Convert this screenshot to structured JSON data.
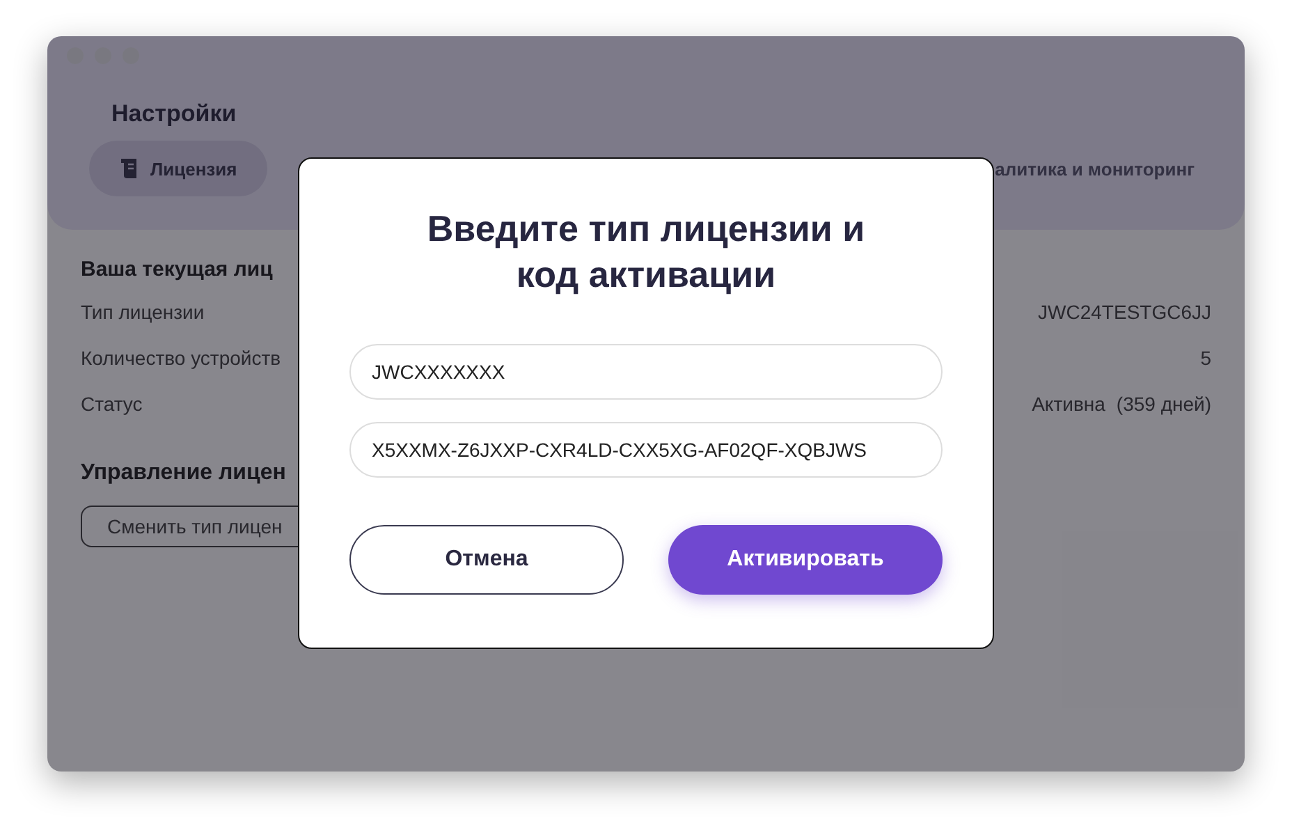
{
  "window": {
    "title": "Настройки"
  },
  "tabs": [
    {
      "label": "Лицензия",
      "selected": true
    },
    {
      "label": "алитика и мониторинг",
      "selected": false
    }
  ],
  "license": {
    "heading": "Ваша текущая лиц",
    "rows": [
      {
        "label": "Тип лицензии",
        "value": "JWC24TESTGC6JJ"
      },
      {
        "label": "Количество устройств",
        "value": "5"
      },
      {
        "label": "Статус",
        "value": "Активна",
        "note": "(359 дней)"
      }
    ]
  },
  "management": {
    "heading": "Управление лицен",
    "button": "Сменить тип лицен"
  },
  "dialog": {
    "title": "Введите тип лицензии и код активации",
    "fields": [
      {
        "value": "JWCXXXXXXX"
      },
      {
        "value": "X5XXMX-Z6JXXP-CXR4LD-CXX5XG-AF02QF-XQBJWS"
      }
    ],
    "buttons": [
      {
        "label": "Отмена",
        "kind": "secondary"
      },
      {
        "label": "Активировать",
        "kind": "primary"
      }
    ]
  }
}
